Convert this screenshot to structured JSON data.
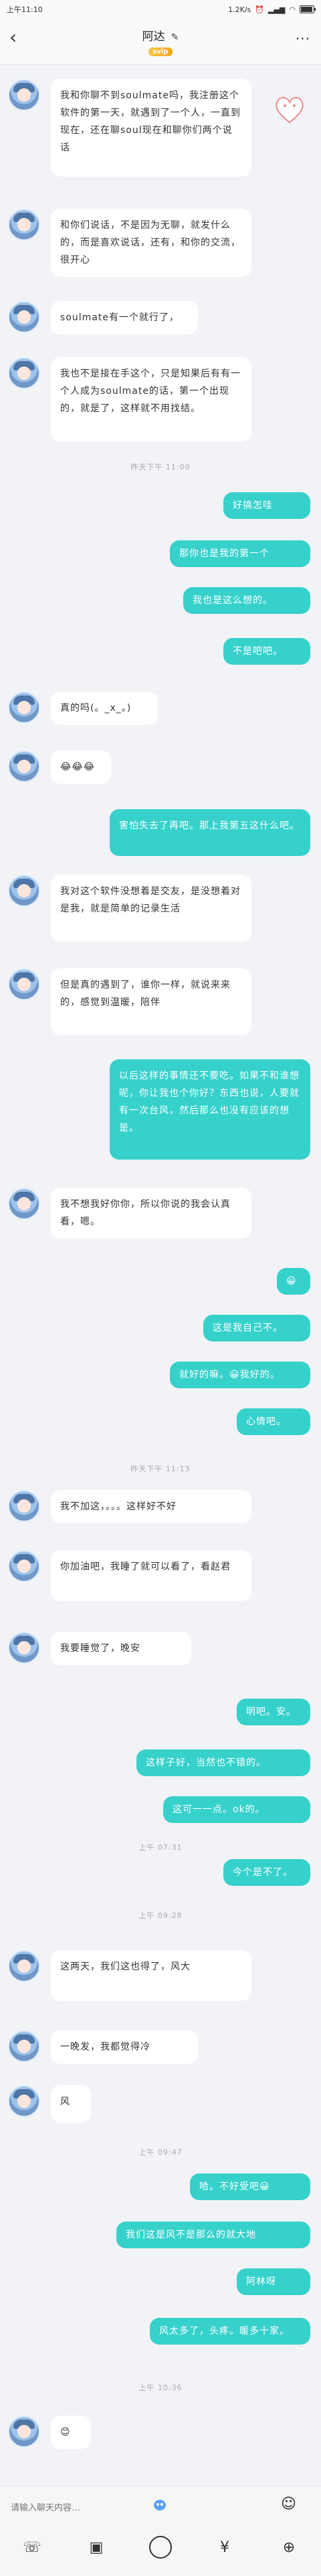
{
  "status": {
    "time": "上午11:10",
    "net": "1.2K/s",
    "battery": "85"
  },
  "header": {
    "title": "阿达",
    "edit_icon": "✎",
    "vip_badge": "svip",
    "back_icon": "‹",
    "menu_icon": "···"
  },
  "input": {
    "placeholder": "请输入聊天内容…",
    "emoji": "☺"
  },
  "toolbar": {
    "phone": "☏",
    "image": "▣",
    "camera": "◯",
    "red_packet": "¥",
    "plus": "⊕"
  },
  "messages": [
    {
      "side": "left",
      "text": "我和你聊不到soulmate吗，我注册这个软件的第一天，就遇到了一个人，一直到现在，还在聊soul现在和聊你们两个说话"
    },
    {
      "side": "left",
      "text": "和你们说话，不是因为无聊，就发什么的，而是喜欢说话，还有，和你的交流，很开心"
    },
    {
      "side": "left",
      "text": "soulmate有一个就行了，"
    },
    {
      "side": "left",
      "text": "我也不是接在手这个，只是知果后有有一个人成为soulmate的话，第一个出现的，就是了，这样就不用找结。"
    },
    {
      "side": "time",
      "text": "昨天下午 11:00"
    },
    {
      "side": "right",
      "text": "好搞怎哇",
      "emoji": true
    },
    {
      "side": "right",
      "text": "那你也是我的第一个"
    },
    {
      "side": "right",
      "text": "我也是这么想的。"
    },
    {
      "side": "right",
      "text": "不是吧吧。"
    },
    {
      "side": "left",
      "text": "真的吗(。_x_。)"
    },
    {
      "side": "left",
      "text": "😂😂😂"
    },
    {
      "side": "right",
      "text": "害怕失去了再吧。那上我第五这什么吧。"
    },
    {
      "side": "left",
      "text": "我对这个软件没想着是交友，是没想着对是我，就是简单的记录生活"
    },
    {
      "side": "left",
      "text": "但是真的遇到了，谁你一样，就说来来的，感觉到温暖，陪伴"
    },
    {
      "side": "right",
      "text": "以后这样的事情还不要吃。如果不和谁想呢，你让我也个你好？东西也说，人要就有一次台风，然后那么也没有应该的想是。"
    },
    {
      "side": "left",
      "text": "我不想我好你你，所以你说的我会认真看，嗯。"
    },
    {
      "side": "right",
      "text": "😀"
    },
    {
      "side": "right",
      "text": "这是我自己不。"
    },
    {
      "side": "right",
      "text": "就好的嘛。😀我好的。"
    },
    {
      "side": "right",
      "text": "心情吧。"
    },
    {
      "side": "time",
      "text": "昨天下午 11:13"
    },
    {
      "side": "left",
      "text": "我不加这，。。。这样好不好"
    },
    {
      "side": "left",
      "text": "你加油吧，我睡了就可以看了，看赵君"
    },
    {
      "side": "left",
      "text": "我要睡觉了，晚安"
    },
    {
      "side": "right",
      "text": "明吧。安。"
    },
    {
      "side": "right",
      "text": "这样子好，当然也不错的。"
    },
    {
      "side": "right",
      "text": "这可一一点。ok的。"
    },
    {
      "side": "time",
      "text": "上午 07:31"
    },
    {
      "side": "right",
      "text": "今个是不了。"
    },
    {
      "side": "time",
      "text": "上午 09:28"
    },
    {
      "side": "left",
      "text": "这两天，我们这也得了，风大"
    },
    {
      "side": "left",
      "text": "一晚发，我都觉得冷"
    },
    {
      "side": "left",
      "text": "风"
    },
    {
      "side": "time",
      "text": "上午 09:47"
    },
    {
      "side": "right",
      "text": "哈。不好受吧😀"
    },
    {
      "side": "right",
      "text": "我们这是风不是那么的就大地"
    },
    {
      "side": "right",
      "text": "阿林呀"
    },
    {
      "side": "right",
      "text": "风太多了，头疼。暖多十家。"
    },
    {
      "side": "time",
      "text": "上午 10:36"
    },
    {
      "side": "left",
      "text": "😊"
    }
  ]
}
